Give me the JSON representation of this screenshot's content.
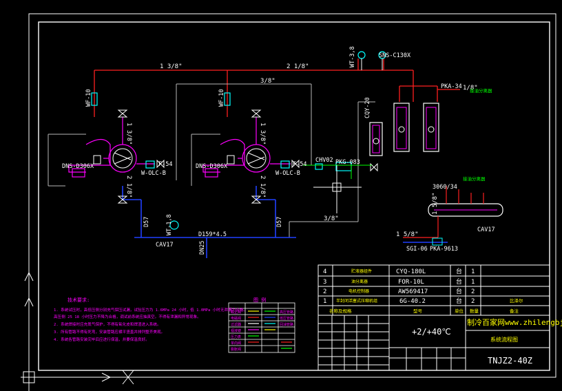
{
  "pipe_labels": {
    "top_left": "1 3/8\"",
    "top_mid": "2 1/8\"",
    "gray_top": "3/8\"",
    "right_top": "1/8\"",
    "left_vertical_a": "1 3/8\"",
    "left_vertical_b": "2 1/8\"",
    "right_vertical_a": "1 3/8\"",
    "right_vertical_b": "2 1/8\"",
    "bottom_gray": "3/8\"",
    "lower_right_pipe": "1 5/8\"",
    "vertical_small": "1 5/8\""
  },
  "components": {
    "wf_left": "WF-10",
    "wf_right": "WF-10",
    "gauge_top": "WT-3,8",
    "sensor_top": "SNS-C130X",
    "pka": "PKA-34",
    "pka_note": "接油分离器",
    "compressor_left": "DNS-D306X",
    "compressor_right": "DNS-D306X",
    "valve_left_f": "F-54",
    "valve_left_w": "W-OLC-B",
    "valve_right_f": "F-54",
    "valve_right_w": "W-OLC-B",
    "chv": "CHV02",
    "pkg": "PKG-083",
    "cqy": "CQY-20",
    "header_d": "D57",
    "header_d2": "D57",
    "header_main": "D159*4.5",
    "cav_left": "CAV17",
    "wt_low": "WT-1,8",
    "dn_low": "DN25",
    "receiver_top": "3060/34",
    "receiver_note": "接油分离器",
    "receiver_cav": "CAV17",
    "sgi": "SGI-06",
    "pka2": "PKA-9613"
  },
  "bom": [
    {
      "no": "4",
      "name": "贮液器组件",
      "model": "CYQ-180L",
      "unit": "台",
      "qty": "1",
      "note": ""
    },
    {
      "no": "3",
      "name": "油分离器",
      "model": "FOR-10L",
      "unit": "台",
      "qty": "1",
      "note": ""
    },
    {
      "no": "2",
      "name": "电机控制器",
      "model": "AW569417",
      "unit": "台",
      "qty": "2",
      "note": ""
    },
    {
      "no": "1",
      "name": "半封闭活塞式压缩机组",
      "model": "6G-40.2",
      "unit": "台",
      "qty": "2",
      "note": "比泽尔"
    }
  ],
  "bom_header": {
    "no": "序号",
    "name": "名称及规格",
    "model": "型号",
    "unit": "单位",
    "qty": "数量",
    "note": "备注"
  },
  "title_block": {
    "temp": "+2/+40℃",
    "site_brand": "制冷百家网www.zhilengbj",
    "drawing_name": "系统流程图",
    "drawing_no": "TNJZ2-40Z"
  },
  "notes": {
    "heading": "技术要求:",
    "lines": [
      "1. 系统试压时，高低压侧分别充气保压试漏，试验压力为 1.6MPa  24 小时，低 1.0MPa 小时无泄漏为合格。",
      "   高压侧 25  18 小时压力不降为合格，调试前系统应抽真空。不得有泄漏和异常现象。",
      "2. 系统焊接时应充氮气保护，不得有氧化皮和焊渣进入系统。",
      "3. 所有管路不得有死弯，安装管路应横平竖直并排列整齐美观。",
      "4. 系统各管路安装完毕后应进行保温，并要保温良好。"
    ]
  },
  "legend": {
    "heading": "图 例",
    "items": [
      "截止阀",
      "电磁阀",
      "过滤器",
      "视液镜",
      "压力表",
      "单向阀",
      "膨胀阀",
      "高压管路",
      "低压管路",
      "回油管路"
    ]
  }
}
